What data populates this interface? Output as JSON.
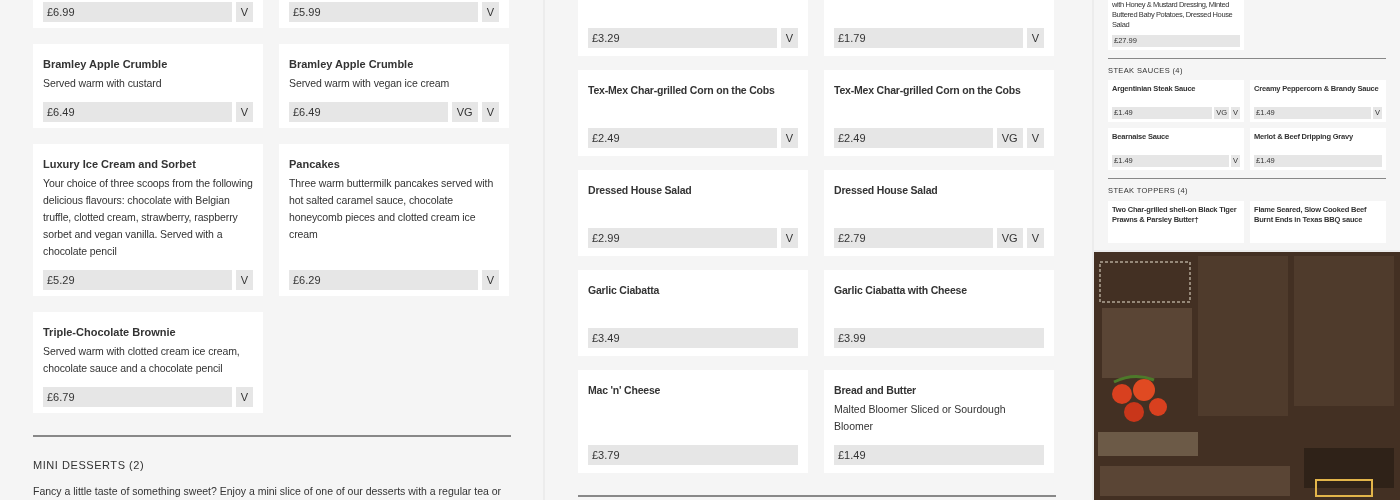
{
  "panels": [
    {
      "items": [
        {
          "kind": "cards",
          "cards": [
            {
              "price": "£6.99",
              "tags": [
                "V"
              ]
            },
            {
              "price": "£5.99",
              "tags": [
                "V"
              ]
            }
          ]
        },
        {
          "kind": "cards",
          "cards": [
            {
              "title": "Bramley Apple Crumble",
              "description": "Served warm with custard",
              "price": "£6.49",
              "tags": [
                "V"
              ]
            },
            {
              "title": "Bramley Apple Crumble",
              "description": "Served warm with vegan ice cream",
              "price": "£6.49",
              "tags": [
                "VG",
                "V"
              ]
            }
          ]
        },
        {
          "kind": "cards",
          "cards": [
            {
              "title": "Luxury Ice Cream and Sorbet",
              "description": "Your choice of three scoops from the following delicious flavours: chocolate with Belgian truffle, clotted cream, strawberry, raspberry sorbet and vegan vanilla. Served with a chocolate pencil",
              "price": "£5.29",
              "tags": [
                "V"
              ]
            },
            {
              "title": "Pancakes",
              "description": "Three warm buttermilk pancakes served with hot salted caramel sauce, chocolate honeycomb pieces and clotted cream ice cream",
              "price": "£6.29",
              "tags": [
                "V"
              ]
            }
          ]
        },
        {
          "kind": "cards",
          "cards": [
            {
              "title": "Triple-Chocolate Brownie",
              "description": "Served warm with clotted cream ice cream, chocolate sauce and a chocolate pencil",
              "price": "£6.79",
              "tags": [
                "V"
              ]
            }
          ]
        },
        {
          "kind": "divider"
        },
        {
          "kind": "heading",
          "text": "MINI DESSERTS (2)"
        },
        {
          "kind": "text",
          "text": "Fancy a little taste of something sweet? Enjoy a mini slice of one of our desserts with a regular tea or"
        }
      ]
    },
    {
      "items": [
        {
          "kind": "cards",
          "cards": [
            {
              "price": "£3.29",
              "tags": [
                "V"
              ]
            },
            {
              "price": "£1.79",
              "tags": [
                "V"
              ]
            }
          ]
        },
        {
          "kind": "cards",
          "cards": [
            {
              "title": "Tex-Mex Char-grilled Corn on the Cobs",
              "price": "£2.49",
              "tags": [
                "V"
              ]
            },
            {
              "title": "Tex-Mex Char-grilled Corn on the Cobs",
              "price": "£2.49",
              "tags": [
                "VG",
                "V"
              ]
            }
          ]
        },
        {
          "kind": "cards",
          "cards": [
            {
              "title": "Dressed House Salad",
              "price": "£2.99",
              "tags": [
                "V"
              ]
            },
            {
              "title": "Dressed House Salad",
              "price": "£2.79",
              "tags": [
                "VG",
                "V"
              ]
            }
          ]
        },
        {
          "kind": "cards",
          "cards": [
            {
              "title": "Garlic Ciabatta",
              "price": "£3.49"
            },
            {
              "title": "Garlic Ciabatta with Cheese",
              "price": "£3.99"
            }
          ]
        },
        {
          "kind": "cards",
          "cards": [
            {
              "title": "Mac 'n' Cheese",
              "price": "£3.79"
            },
            {
              "title": "Bread and Butter",
              "description": "Malted Bloomer Sliced or Sourdough Bloomer",
              "price": "£1.49"
            }
          ]
        },
        {
          "kind": "divider"
        }
      ]
    },
    {
      "items": [
        {
          "kind": "cards",
          "cards": [
            {
              "description": "with Honey & Mustard Dressing, Minted Buttered Baby Potatoes, Dressed House Salad",
              "price": "£27.99"
            }
          ]
        },
        {
          "kind": "divider"
        },
        {
          "kind": "heading",
          "text": "STEAK SAUCES (4)"
        },
        {
          "kind": "cards",
          "cards": [
            {
              "title": "Argentinian Steak Sauce",
              "price": "£1.49",
              "tags": [
                "VG",
                "V"
              ]
            },
            {
              "title": "Creamy Peppercorn & Brandy Sauce",
              "price": "£1.49",
              "tags": [
                "V"
              ]
            }
          ]
        },
        {
          "kind": "cards",
          "cards": [
            {
              "title": "Bearnaise Sauce",
              "price": "£1.49",
              "tags": [
                "V"
              ]
            },
            {
              "title": "Merlot & Beef Dripping Gravy",
              "price": "£1.49"
            }
          ]
        },
        {
          "kind": "divider"
        },
        {
          "kind": "heading",
          "text": "STEAK TOPPERS (4)"
        },
        {
          "kind": "cards",
          "cards": [
            {
              "title": "Two Char-grilled shell-on Black Tiger Prawns & Parsley Butter†"
            },
            {
              "title": "Flame Seared, Slow Cooked Beef Burnt Ends in Texas BBQ sauce"
            }
          ]
        }
      ]
    },
    {
      "kind": "picture"
    }
  ]
}
